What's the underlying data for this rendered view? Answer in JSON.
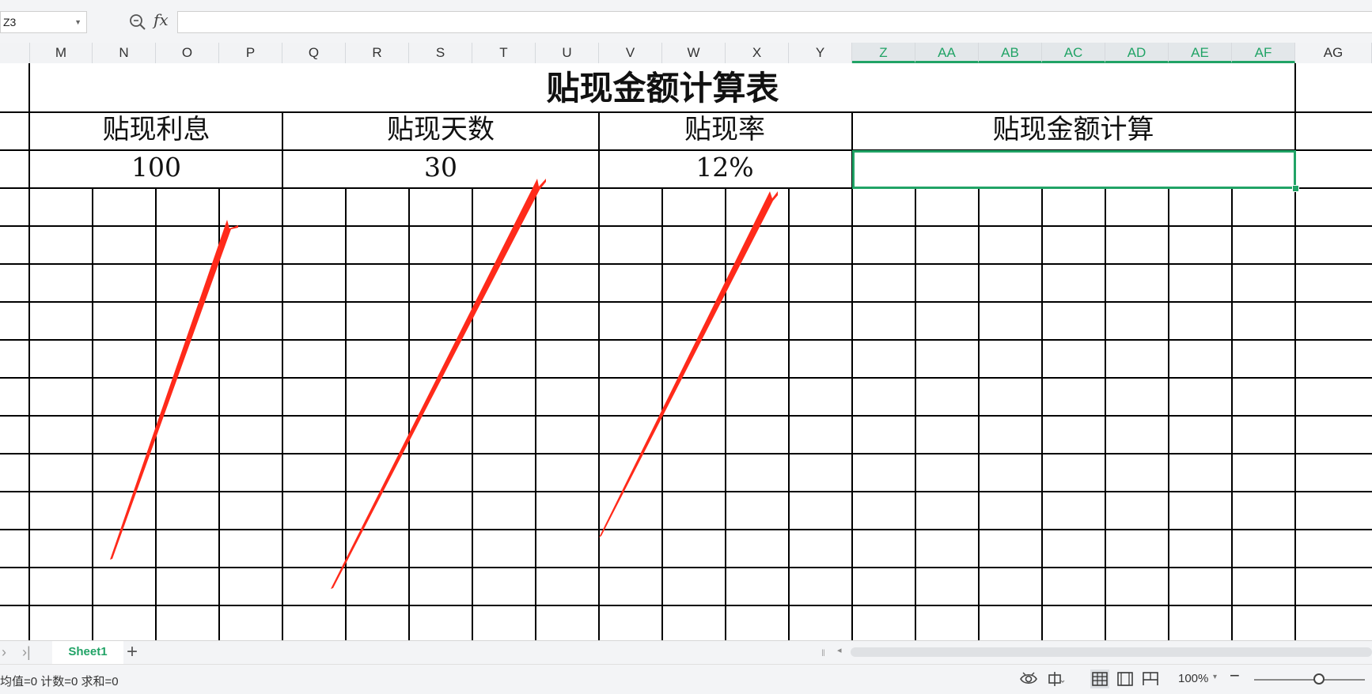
{
  "formula_bar": {
    "name_box_value": "Z3",
    "fx_label": "fx",
    "formula_value": ""
  },
  "columns": [
    {
      "label": "",
      "selected": false
    },
    {
      "label": "M",
      "selected": false
    },
    {
      "label": "N",
      "selected": false
    },
    {
      "label": "O",
      "selected": false
    },
    {
      "label": "P",
      "selected": false
    },
    {
      "label": "Q",
      "selected": false
    },
    {
      "label": "R",
      "selected": false
    },
    {
      "label": "S",
      "selected": false
    },
    {
      "label": "T",
      "selected": false
    },
    {
      "label": "U",
      "selected": false
    },
    {
      "label": "V",
      "selected": false
    },
    {
      "label": "W",
      "selected": false
    },
    {
      "label": "X",
      "selected": false
    },
    {
      "label": "Y",
      "selected": false
    },
    {
      "label": "Z",
      "selected": true
    },
    {
      "label": "AA",
      "selected": true
    },
    {
      "label": "AB",
      "selected": true
    },
    {
      "label": "AC",
      "selected": true
    },
    {
      "label": "AD",
      "selected": true
    },
    {
      "label": "AE",
      "selected": true
    },
    {
      "label": "AF",
      "selected": true
    },
    {
      "label": "AG",
      "selected": false
    }
  ],
  "sheet": {
    "title": "贴现金额计算表",
    "headers": {
      "interest": "贴现利息",
      "days": "贴现天数",
      "rate": "贴现率",
      "amount": "贴现金额计算"
    },
    "values": {
      "interest": "100",
      "days": "30",
      "rate": "12%",
      "amount": ""
    }
  },
  "tabs": {
    "sheet_name": "Sheet1",
    "add_label": "+"
  },
  "status_bar": {
    "stats": "均值=0  计数=0  求和=0",
    "zoom": "100%"
  },
  "colors": {
    "accent": "#21a366",
    "arrow": "#ff2a1a"
  }
}
